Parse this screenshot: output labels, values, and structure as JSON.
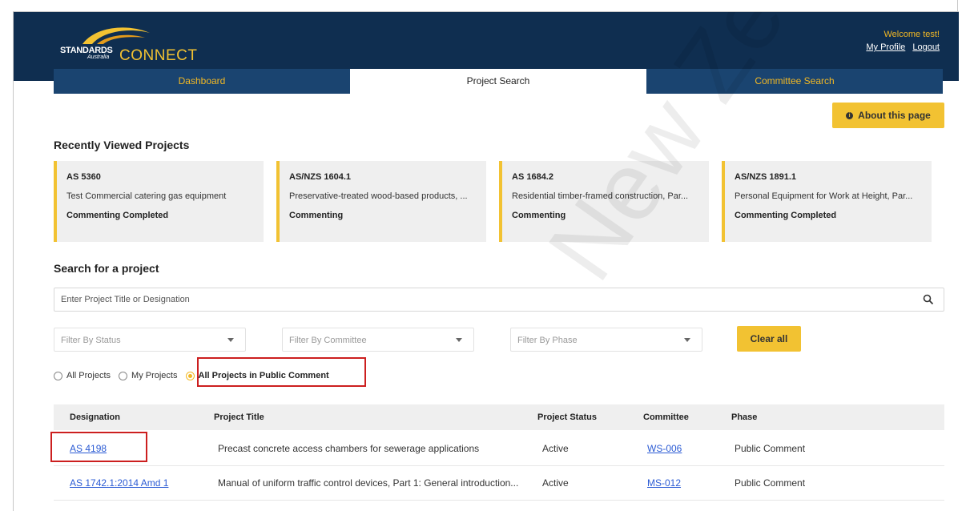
{
  "header": {
    "logo_standards": "STANDARDS",
    "logo_australia": "Australia",
    "logo_connect": "CONNECT",
    "welcome": "Welcome test!",
    "profile_link": "My Profile",
    "logout_link": "Logout"
  },
  "tabs": [
    {
      "label": "Dashboard",
      "active": false
    },
    {
      "label": "Project Search",
      "active": true
    },
    {
      "label": "Committee Search",
      "active": false
    }
  ],
  "about_button": "About this page",
  "recent": {
    "title": "Recently Viewed Projects",
    "cards": [
      {
        "designation": "AS 5360",
        "title": "Test Commercial catering gas equipment",
        "status": "Commenting Completed"
      },
      {
        "designation": "AS/NZS 1604.1",
        "title": "Preservative-treated wood-based products, ...",
        "status": "Commenting"
      },
      {
        "designation": "AS 1684.2",
        "title": "Residential timber-framed construction, Par...",
        "status": "Commenting"
      },
      {
        "designation": "AS/NZS 1891.1",
        "title": "Personal Equipment for Work at Height, Par...",
        "status": "Commenting Completed"
      }
    ]
  },
  "search": {
    "title": "Search for a project",
    "placeholder": "Enter Project Title or Designation",
    "filters": [
      "Filter By Status",
      "Filter By Committee",
      "Filter By Phase"
    ],
    "clear_all": "Clear all",
    "radios": [
      {
        "label": "All Projects",
        "checked": false
      },
      {
        "label": "My Projects",
        "checked": false
      },
      {
        "label": "All Projects in Public Comment",
        "checked": true
      }
    ]
  },
  "table": {
    "headers": [
      "Designation",
      "Project Title",
      "Project Status",
      "Committee",
      "Phase"
    ],
    "rows": [
      {
        "designation": "AS 4198",
        "title": "Precast concrete access chambers for sewerage applications",
        "status": "Active",
        "committee": "WS-006",
        "phase": "Public Comment"
      },
      {
        "designation": "AS 1742.1:2014 Amd 1",
        "title": "Manual of uniform traffic control devices, Part 1: General introduction...",
        "status": "Active",
        "committee": "MS-012",
        "phase": "Public Comment"
      }
    ]
  },
  "watermark": "New Zealand",
  "colors": {
    "navy": "#0f2e50",
    "accent": "#f2c232",
    "link": "#2b5bd4",
    "highlight": "#cc1f1f"
  }
}
